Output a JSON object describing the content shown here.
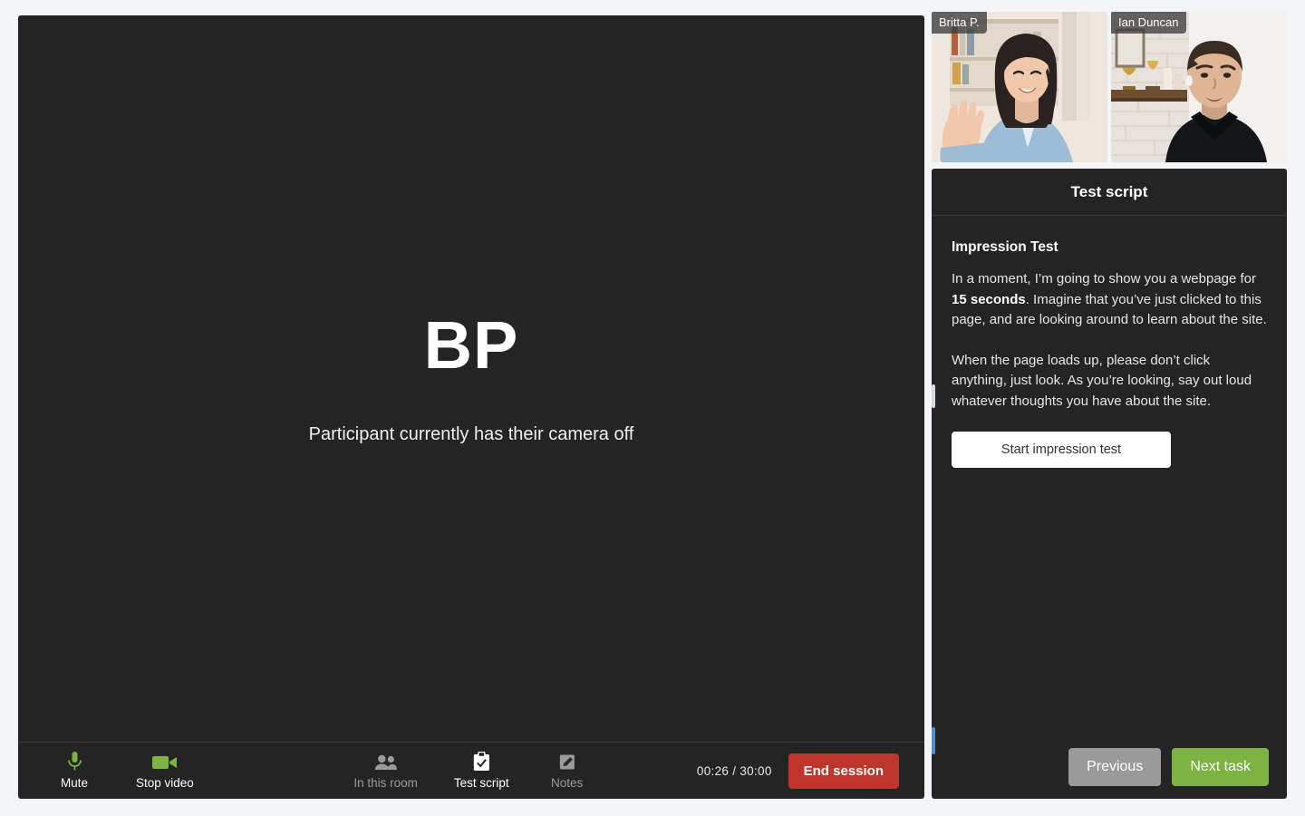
{
  "stage": {
    "initials": "BP",
    "camera_off_message": "Participant currently has their camera off"
  },
  "toolbar": {
    "mute_label": "Mute",
    "mute_icon": "microphone-icon",
    "stop_video_label": "Stop video",
    "stop_video_icon": "video-camera-icon",
    "in_this_room_label": "In this room",
    "in_this_room_icon": "people-icon",
    "test_script_label": "Test script",
    "test_script_icon": "clipboard-check-icon",
    "notes_label": "Notes",
    "notes_icon": "pencil-icon",
    "timer": "00:26 / 30:00",
    "end_session_label": "End session",
    "end_session_color": "#c0352b",
    "active_icon_color": "#7cb342",
    "inactive_label_color": "#9a9a9a"
  },
  "participants": [
    {
      "name": "Britta P."
    },
    {
      "name": "Ian Duncan"
    }
  ],
  "script_panel": {
    "header_title": "Test script",
    "task_title": "Impression Test",
    "paragraph_1_a": "In a moment, I’m going to show you a webpage for ",
    "paragraph_1_bold": "15 seconds",
    "paragraph_1_b": ". Imagine that you’ve just clicked to this page, and are looking around to learn about the site.",
    "paragraph_2": "When the page loads up, please don’t click anything, just look. As you’re looking, say out loud whatever thoughts you have about the site.",
    "start_button_label": "Start impression test",
    "previous_label": "Previous",
    "next_label": "Next task",
    "previous_color": "#9a9a9a",
    "next_color": "#7cb342"
  },
  "handles": {
    "resize_handle": "resize-handle",
    "scroll_handle": "scroll-handle",
    "scroll_handle_color": "#4a90e2"
  }
}
